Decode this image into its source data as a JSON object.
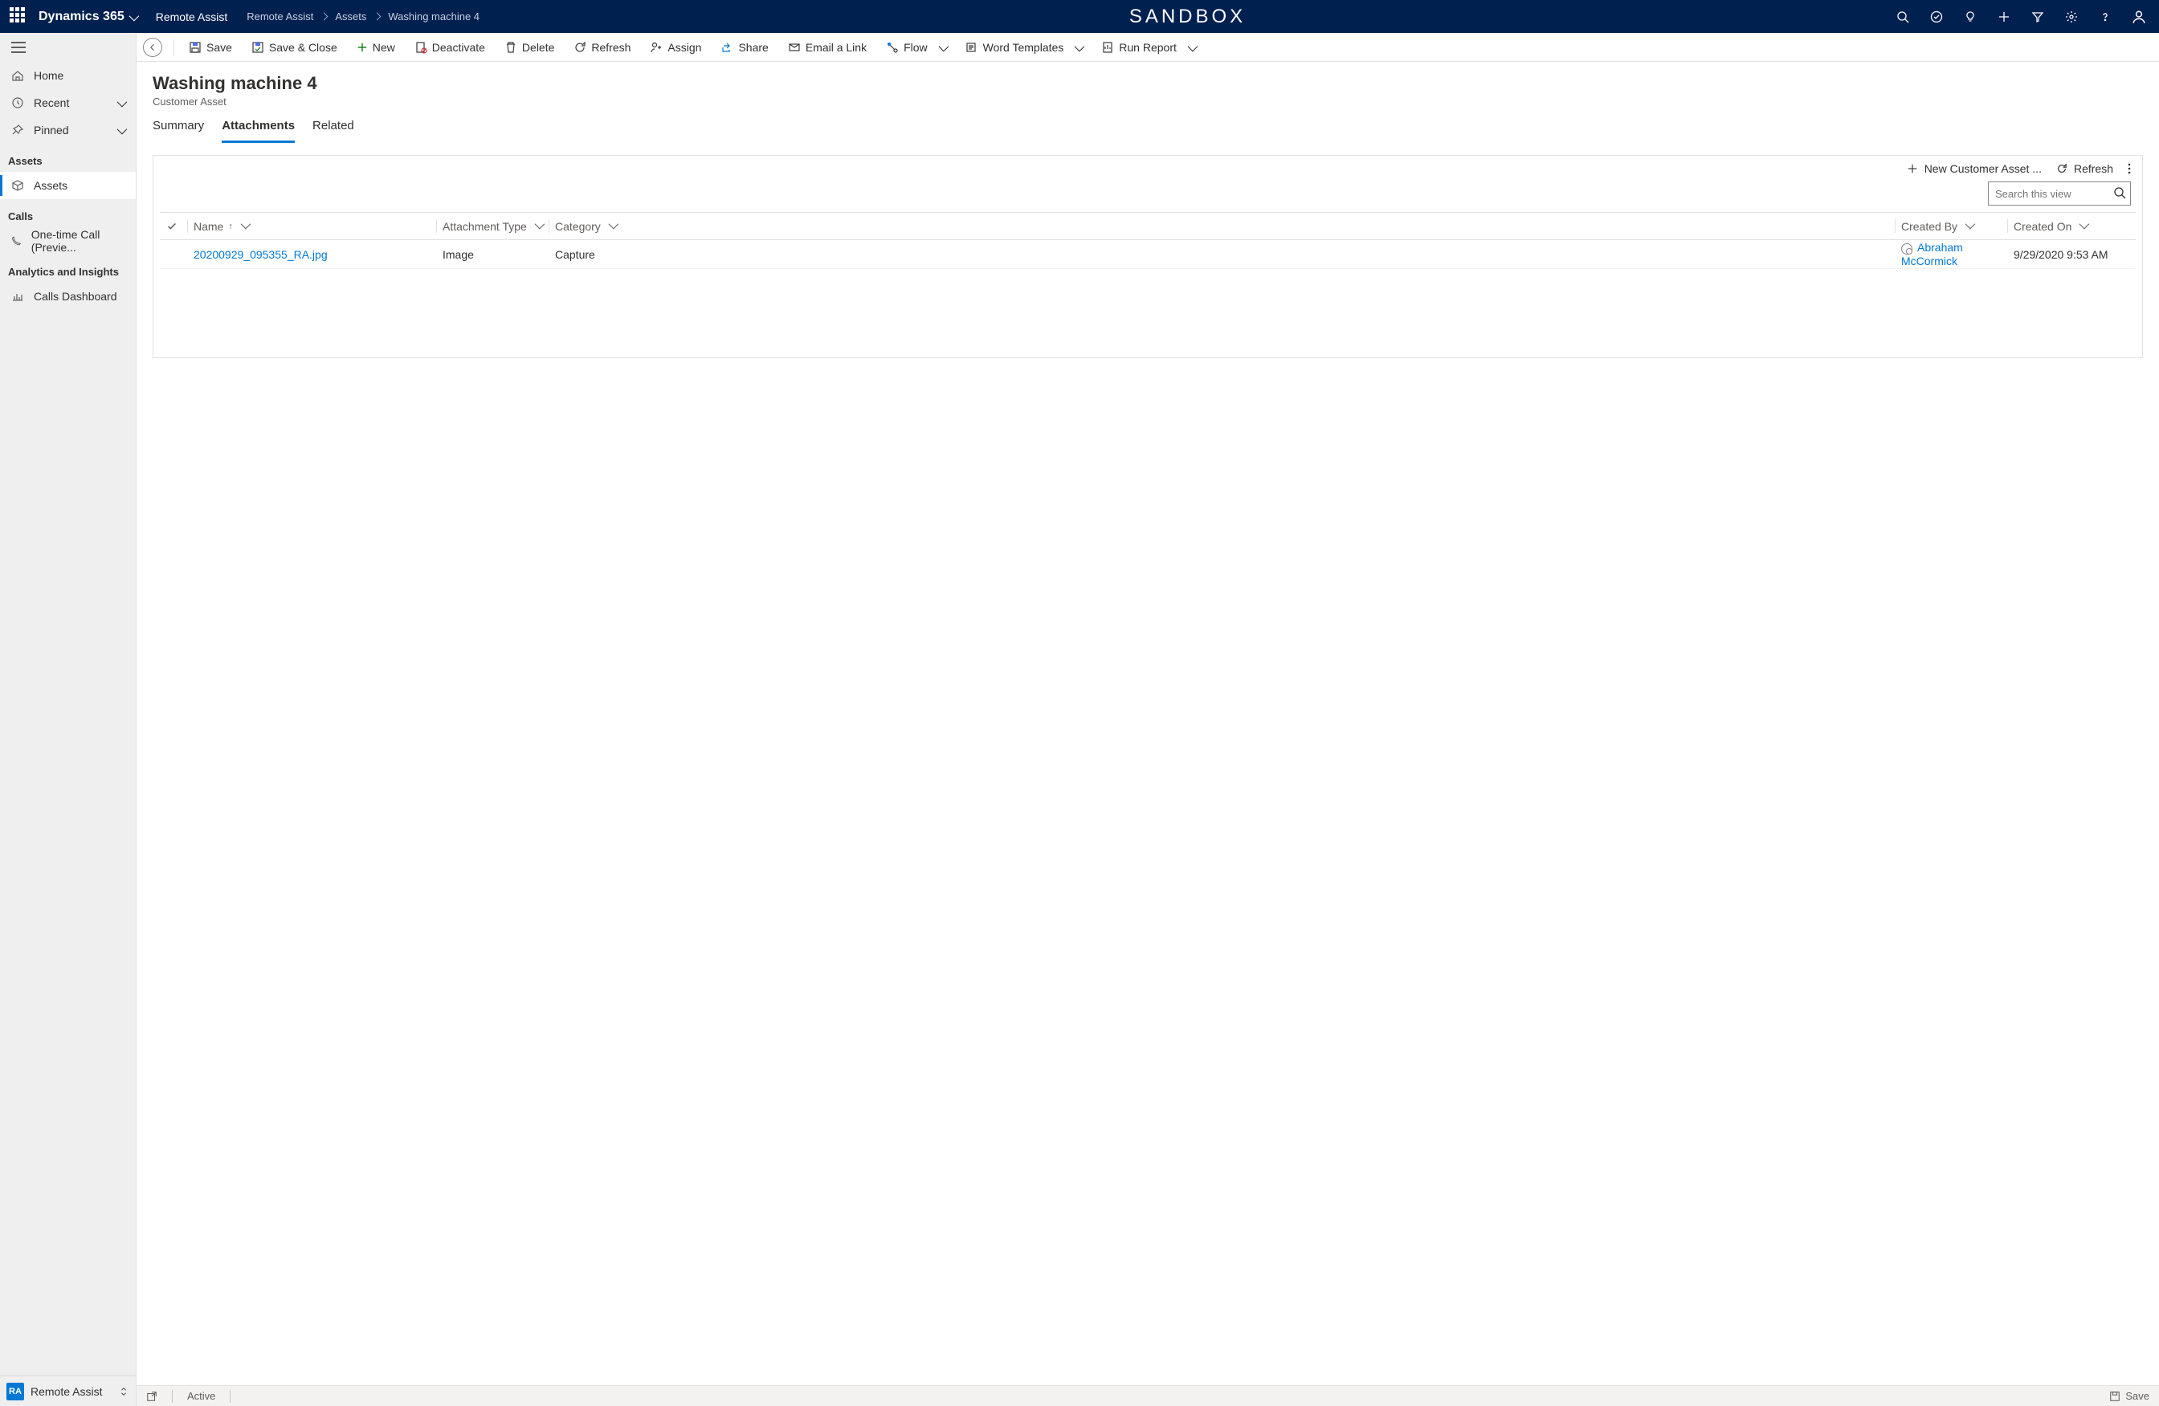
{
  "topbar": {
    "brand": "Dynamics 365",
    "app": "Remote Assist",
    "center": "SANDBOX",
    "breadcrumbs": [
      "Remote Assist",
      "Assets",
      "Washing machine 4"
    ]
  },
  "sidebar": {
    "items": [
      {
        "label": "Home"
      },
      {
        "label": "Recent"
      },
      {
        "label": "Pinned"
      }
    ],
    "groups": [
      {
        "title": "Assets",
        "items": [
          {
            "label": "Assets",
            "active": true
          }
        ]
      },
      {
        "title": "Calls",
        "items": [
          {
            "label": "One-time Call (Previe..."
          }
        ]
      },
      {
        "title": "Analytics and Insights",
        "items": [
          {
            "label": "Calls Dashboard"
          }
        ]
      }
    ],
    "footer": {
      "badge": "RA",
      "label": "Remote Assist"
    }
  },
  "commands": {
    "save": "Save",
    "save_close": "Save & Close",
    "new": "New",
    "deactivate": "Deactivate",
    "delete": "Delete",
    "refresh": "Refresh",
    "assign": "Assign",
    "share": "Share",
    "email": "Email a Link",
    "flow": "Flow",
    "word": "Word Templates",
    "report": "Run Report"
  },
  "record": {
    "title": "Washing machine  4",
    "subtitle": "Customer Asset"
  },
  "tabs": [
    "Summary",
    "Attachments",
    "Related"
  ],
  "active_tab": "Attachments",
  "panel": {
    "new_label": "New Customer Asset ...",
    "refresh_label": "Refresh",
    "search_placeholder": "Search this view",
    "columns": [
      "Name",
      "Attachment Type",
      "Category",
      "Created By",
      "Created On"
    ],
    "rows": [
      {
        "name": "20200929_095355_RA.jpg",
        "attachment_type": "Image",
        "category": "Capture",
        "created_by": "Abraham McCormick",
        "created_on": "9/29/2020 9:53 AM"
      }
    ]
  },
  "statusbar": {
    "state": "Active",
    "save": "Save"
  }
}
